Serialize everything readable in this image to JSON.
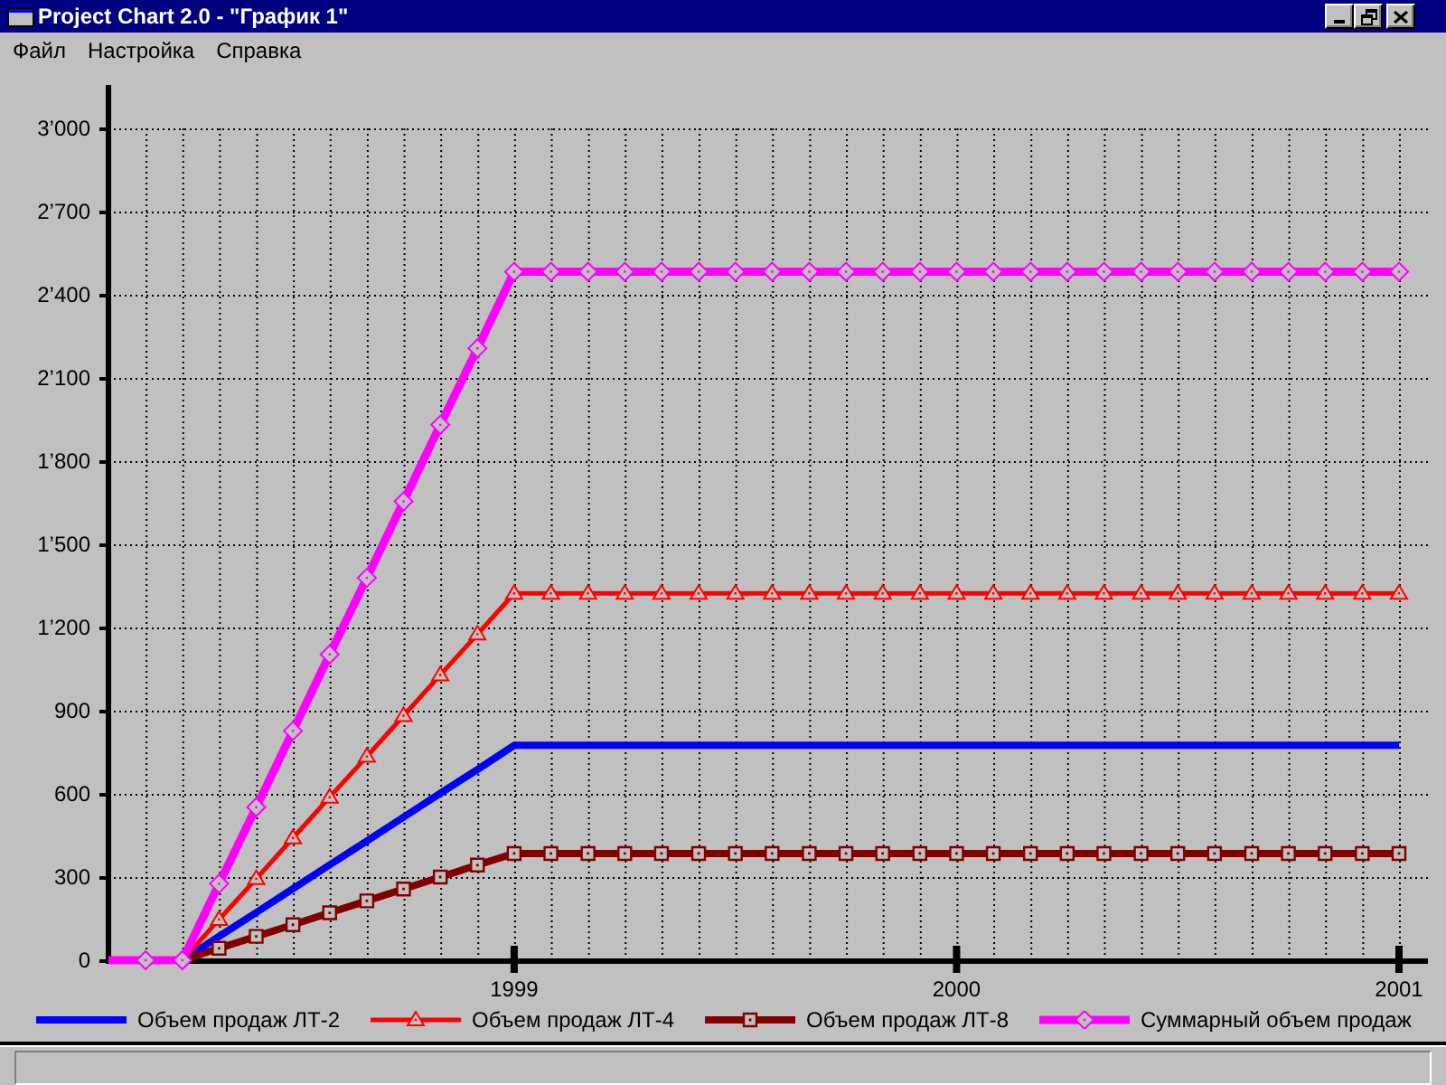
{
  "window": {
    "title": "Project Chart 2.0 - \"График 1\""
  },
  "menu": [
    "Файл",
    "Настройка",
    "Справка"
  ],
  "chart": {
    "chart_data": {
      "type": "line",
      "grid": true,
      "x": [
        1998.083,
        1998.167,
        1998.25,
        1998.333,
        1998.417,
        1998.5,
        1998.583,
        1998.667,
        1998.75,
        1998.833,
        1998.917,
        1999,
        1999.083,
        1999.167,
        1999.25,
        1999.333,
        1999.417,
        1999.5,
        1999.583,
        1999.667,
        1999.75,
        1999.833,
        1999.917,
        2000,
        2000.083,
        2000.167,
        2000.25,
        2000.333,
        2000.417,
        2000.5,
        2000.583,
        2000.667,
        2000.75,
        2000.833,
        2000.917,
        2001
      ],
      "xlim": [
        1998.083,
        2001
      ],
      "ylim": [
        0,
        3000
      ],
      "xticks": [
        1999,
        2000,
        2001
      ],
      "yticks": [
        {
          "value": 0,
          "label": "0"
        },
        {
          "value": 300,
          "label": "300"
        },
        {
          "value": 600,
          "label": "600"
        },
        {
          "value": 900,
          "label": "900"
        },
        {
          "value": 1200,
          "label": "1’200"
        },
        {
          "value": 1500,
          "label": "1’500"
        },
        {
          "value": 1800,
          "label": "1’800"
        },
        {
          "value": 2100,
          "label": "2’100"
        },
        {
          "value": 2400,
          "label": "2’400"
        },
        {
          "value": 2700,
          "label": "2’700"
        },
        {
          "value": 3000,
          "label": "3’000"
        }
      ],
      "series": [
        {
          "name": "Объем продаж ЛТ-2",
          "color": "#0000ff",
          "values": [
            0,
            0,
            0,
            86,
            172,
            258,
            344,
            430,
            516,
            602,
            688,
            775,
            775,
            775,
            775,
            775,
            775,
            775,
            775,
            775,
            775,
            775,
            775,
            775,
            775,
            775,
            775,
            775,
            775,
            775,
            775,
            775,
            775,
            775,
            775,
            775
          ]
        },
        {
          "name": "Объем продаж ЛТ-4",
          "color": "#ff0000",
          "marker": "triangle",
          "values": [
            0,
            0,
            0,
            147,
            294,
            441,
            588,
            735,
            882,
            1029,
            1176,
            1323,
            1323,
            1323,
            1323,
            1323,
            1323,
            1323,
            1323,
            1323,
            1323,
            1323,
            1323,
            1323,
            1323,
            1323,
            1323,
            1323,
            1323,
            1323,
            1323,
            1323,
            1323,
            1323,
            1323,
            1323
          ]
        },
        {
          "name": "Объем продаж ЛТ-8",
          "color": "#800000",
          "marker": "square",
          "values": [
            0,
            0,
            0,
            43,
            86,
            128,
            171,
            214,
            257,
            300,
            343,
            385,
            385,
            385,
            385,
            385,
            385,
            385,
            385,
            385,
            385,
            385,
            385,
            385,
            385,
            385,
            385,
            385,
            385,
            385,
            385,
            385,
            385,
            385,
            385,
            385
          ]
        },
        {
          "name": "Суммарный объем продаж",
          "color": "#ff00ff",
          "marker": "diamond",
          "values": [
            0,
            0,
            0,
            276,
            552,
            827,
            1103,
            1379,
            1655,
            1931,
            2207,
            2483,
            2483,
            2483,
            2483,
            2483,
            2483,
            2483,
            2483,
            2483,
            2483,
            2483,
            2483,
            2483,
            2483,
            2483,
            2483,
            2483,
            2483,
            2483,
            2483,
            2483,
            2483,
            2483,
            2483,
            2483
          ]
        }
      ]
    }
  }
}
